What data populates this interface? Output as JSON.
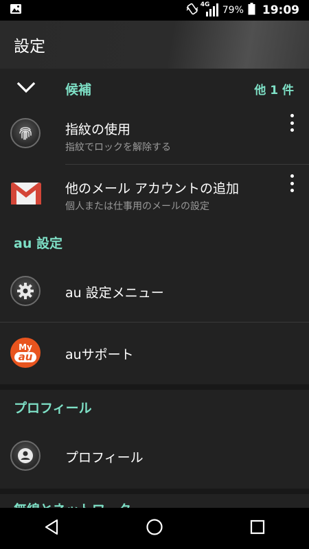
{
  "status_bar": {
    "network": "4G",
    "battery_percent": "79%",
    "time": "19:09"
  },
  "app_bar": {
    "title": "設定"
  },
  "suggestions": {
    "label": "候補",
    "count": "他 1 件",
    "items": [
      {
        "title": "指紋の使用",
        "subtitle": "指紋でロックを解除する",
        "icon": "fingerprint-icon"
      },
      {
        "title": "他のメール アカウントの追加",
        "subtitle": "個人または仕事用のメールの設定",
        "icon": "gmail-icon"
      }
    ]
  },
  "au_section": {
    "title": "au 設定",
    "items": [
      {
        "title": "au 設定メニュー",
        "icon": "gear-icon"
      },
      {
        "title": "auサポート",
        "icon": "my-au-icon",
        "icon_text_top": "My",
        "icon_text_bottom": "au"
      }
    ]
  },
  "profile_section": {
    "title": "プロフィール",
    "items": [
      {
        "title": "プロフィール",
        "icon": "person-icon"
      }
    ]
  },
  "network_section": {
    "title": "無線とネットワーク"
  },
  "colors": {
    "accent": "#7ee0c6",
    "background": "#222222",
    "au_orange": "#e8541e",
    "gmail_red": "#d44638"
  }
}
